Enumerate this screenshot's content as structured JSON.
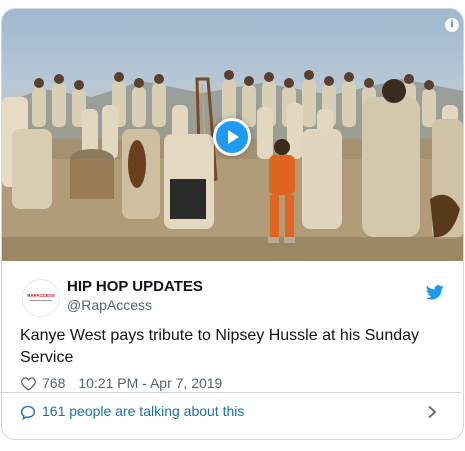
{
  "tweet": {
    "display_name": "HIP HOP UPDATES",
    "handle": "@RapAccess",
    "avatar_text": "RAPACCESS",
    "text": "Kanye West pays tribute to Nipsey Hussle at his Sunday Service",
    "likes": "768",
    "timestamp": "10:21 PM - Apr 7, 2019"
  },
  "media": {
    "type": "video",
    "play_icon": "play-icon",
    "info_icon": "info-icon",
    "info_label": "i"
  },
  "footer": {
    "talking_text": "161 people are talking about this"
  },
  "icons": {
    "brand": "twitter-bird-icon",
    "like": "heart-icon",
    "talk": "speech-bubble-icon",
    "more": "chevron-right-icon"
  },
  "colors": {
    "accent": "#1d9bf0",
    "link": "#1b6eb8",
    "text_primary": "#0f1419",
    "text_secondary": "#536471",
    "border": "#cfd9de",
    "avatar_brand": "#c0172b"
  }
}
